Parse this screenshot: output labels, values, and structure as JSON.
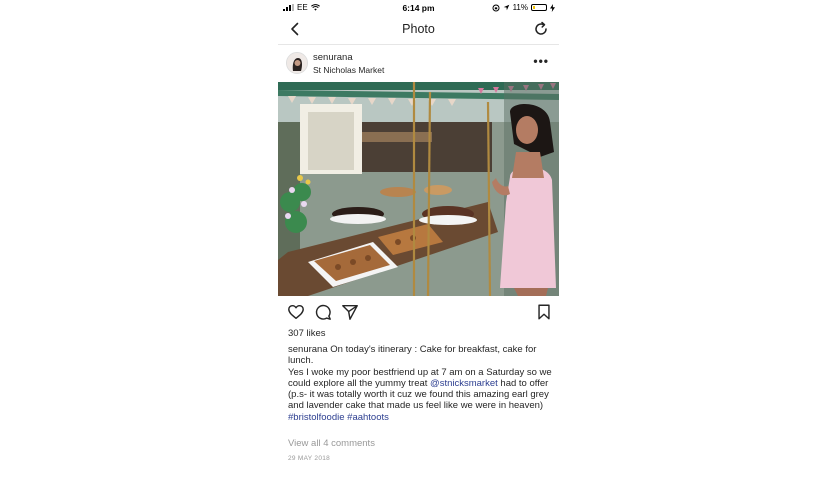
{
  "status_bar": {
    "carrier": "EE",
    "time": "6:14 pm",
    "battery_percent": "11%"
  },
  "nav": {
    "title": "Photo"
  },
  "post": {
    "username": "senurana",
    "location": "St Nicholas Market",
    "more_label": "•••",
    "likes": "307 likes",
    "caption_username": "senurana",
    "caption_text_1": " On today's itinerary : Cake for breakfast, cake for lunch.",
    "caption_text_2a": "Yes I woke my poor bestfriend up at 7 am on a Saturday so we could explore all the yummy treat ",
    "mention": "@stnicksmarket",
    "caption_text_2b": " had to offer (p.s- it was totally worth it cuz we found this amazing earl grey and lavender cake that made us feel like we were in heaven)",
    "hashtag_1": "#bristolfoodie",
    "hashtag_2": "#aahtoots",
    "view_comments": "View all 4 comments",
    "date": "29 MAY 2018"
  },
  "icons": {
    "back": "chevron-left-icon",
    "refresh": "refresh-icon",
    "like": "heart-icon",
    "comment": "comment-icon",
    "share": "paper-plane-icon",
    "save": "bookmark-icon"
  },
  "colors": {
    "link": "#2c3e90",
    "muted": "#999999",
    "text": "#262626"
  }
}
